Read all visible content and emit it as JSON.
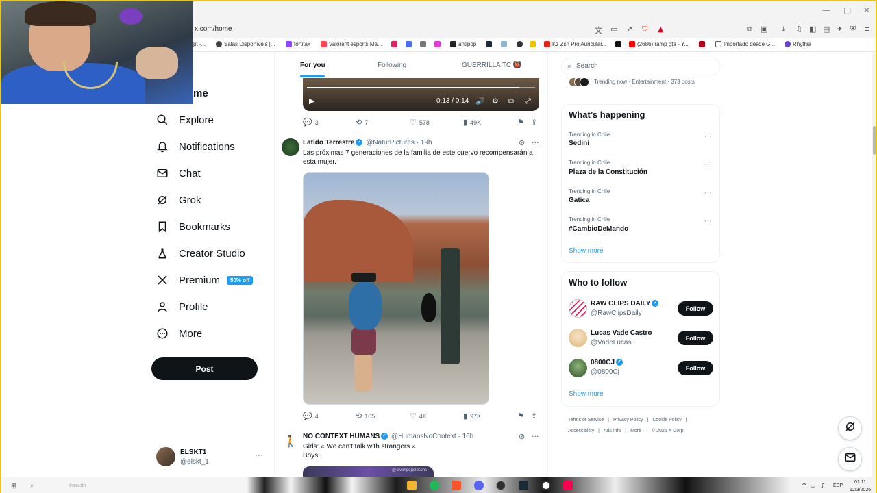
{
  "browser": {
    "url": "x.com/home",
    "bookmarks": [
      "pt -...",
      "Salas Disponíveis |...",
      "tortitax",
      "Valorant esports Ma...",
      "antipop",
      "Kz Zsn Pro Auricular...",
      "(2686) ramp gta - Y...",
      "Importado desde G...",
      "Rhythia"
    ]
  },
  "nav": {
    "home_tail": "me",
    "items": [
      {
        "label": "Explore",
        "icon": "search-icon"
      },
      {
        "label": "Notifications",
        "icon": "bell-icon"
      },
      {
        "label": "Chat",
        "icon": "mail-icon"
      },
      {
        "label": "Grok",
        "icon": "grok-icon"
      },
      {
        "label": "Bookmarks",
        "icon": "bookmark-icon"
      },
      {
        "label": "Creator Studio",
        "icon": "flask-icon"
      },
      {
        "label": "Premium",
        "icon": "x-logo-icon"
      },
      {
        "label": "Profile",
        "icon": "person-icon"
      },
      {
        "label": "More",
        "icon": "more-circle-icon"
      }
    ],
    "premium_badge": "50% off",
    "post_button": "Post",
    "account": {
      "name": "ELSKT1",
      "handle": "@elskt_1"
    }
  },
  "timeline": {
    "tabs": [
      "For you",
      "Following",
      "GUERRILLA TC 👹"
    ],
    "active_tab": 0,
    "video": {
      "time": "0:13 / 0:14",
      "progress": 0.93
    },
    "first_post_actions": {
      "replies": "3",
      "reposts": "7",
      "likes": "578",
      "views": "49K"
    },
    "posts": [
      {
        "name": "Latido Terrestre",
        "handle": "@NaturPictures",
        "time": "· 19h",
        "text": "Las próximas 7 generaciones de la familia de este cuervo recompensarán a esta mujer.",
        "actions": {
          "replies": "4",
          "reposts": "105",
          "likes": "4K",
          "views": "97K"
        }
      },
      {
        "name": "NO CONTEXT HUMANS",
        "handle": "@HumansNoContext",
        "time": "· 16h",
        "text_line1": "Girls: « We can't talk with strangers »",
        "text_line2": "Boys:",
        "media_tag": "@ avengegoldschs"
      }
    ]
  },
  "sidebar": {
    "search_placeholder": "Search",
    "trending_now": "Trending now · Entertainment · 373 posts",
    "whats_happening_title": "What’s happening",
    "trends": [
      {
        "context": "Trending in Chile",
        "name": "Sedini"
      },
      {
        "context": "Trending in Chile",
        "name": "Plaza de la Constitución"
      },
      {
        "context": "Trending in Chile",
        "name": "Gatica"
      },
      {
        "context": "Trending in Chile",
        "name": "#CambioDeMando"
      }
    ],
    "show_more": "Show more",
    "who_to_follow_title": "Who to follow",
    "follow_label": "Follow",
    "accounts": [
      {
        "name": "RAW CLIPS DAILY",
        "handle": "@RawClipsDaily",
        "verified": true
      },
      {
        "name": "Lucas Vade Castro",
        "handle": "@VadeLucas",
        "verified": false
      },
      {
        "name": "0800CJ",
        "handle": "@0800Cj",
        "verified": true
      }
    ],
    "footer": [
      "Terms of Service",
      "|",
      "Privacy Policy",
      "|",
      "Cookie Policy",
      "|",
      "Accessibility",
      "|",
      "Ads info",
      "|",
      "More ···",
      "© 2026 X Corp."
    ]
  },
  "taskbar": {
    "lang": "ESP",
    "time": "01:11",
    "date": "12/3/2026",
    "search_hint": "Intro/stn"
  },
  "colors": {
    "accent": "#1d9bf0",
    "text": "#0f1419",
    "muted": "#536471",
    "frame": "#e8c61a"
  }
}
